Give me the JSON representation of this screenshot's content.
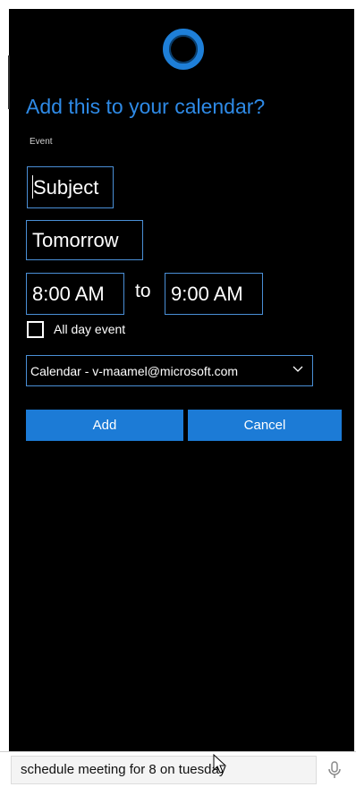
{
  "dialog": {
    "title": "Add this to your calendar?",
    "event_label": "Event",
    "subject": "Subject",
    "date": "Tomorrow",
    "start_time": "8:00 AM",
    "to_label": "to",
    "end_time": "9:00 AM",
    "all_day_label": "All day event",
    "all_day_checked": false,
    "calendar_selected": "Calendar - v-maamel@microsoft.com",
    "add_label": "Add",
    "cancel_label": "Cancel"
  },
  "taskbar": {
    "search_query": "schedule meeting for 8 on tuesday"
  },
  "icons": {
    "assistant": "cortana-ring-icon",
    "dropdown": "chevron-down-icon",
    "microphone": "microphone-icon"
  },
  "colors": {
    "accent": "#1c7bd6",
    "title": "#2e8ae6",
    "background": "#000000"
  }
}
